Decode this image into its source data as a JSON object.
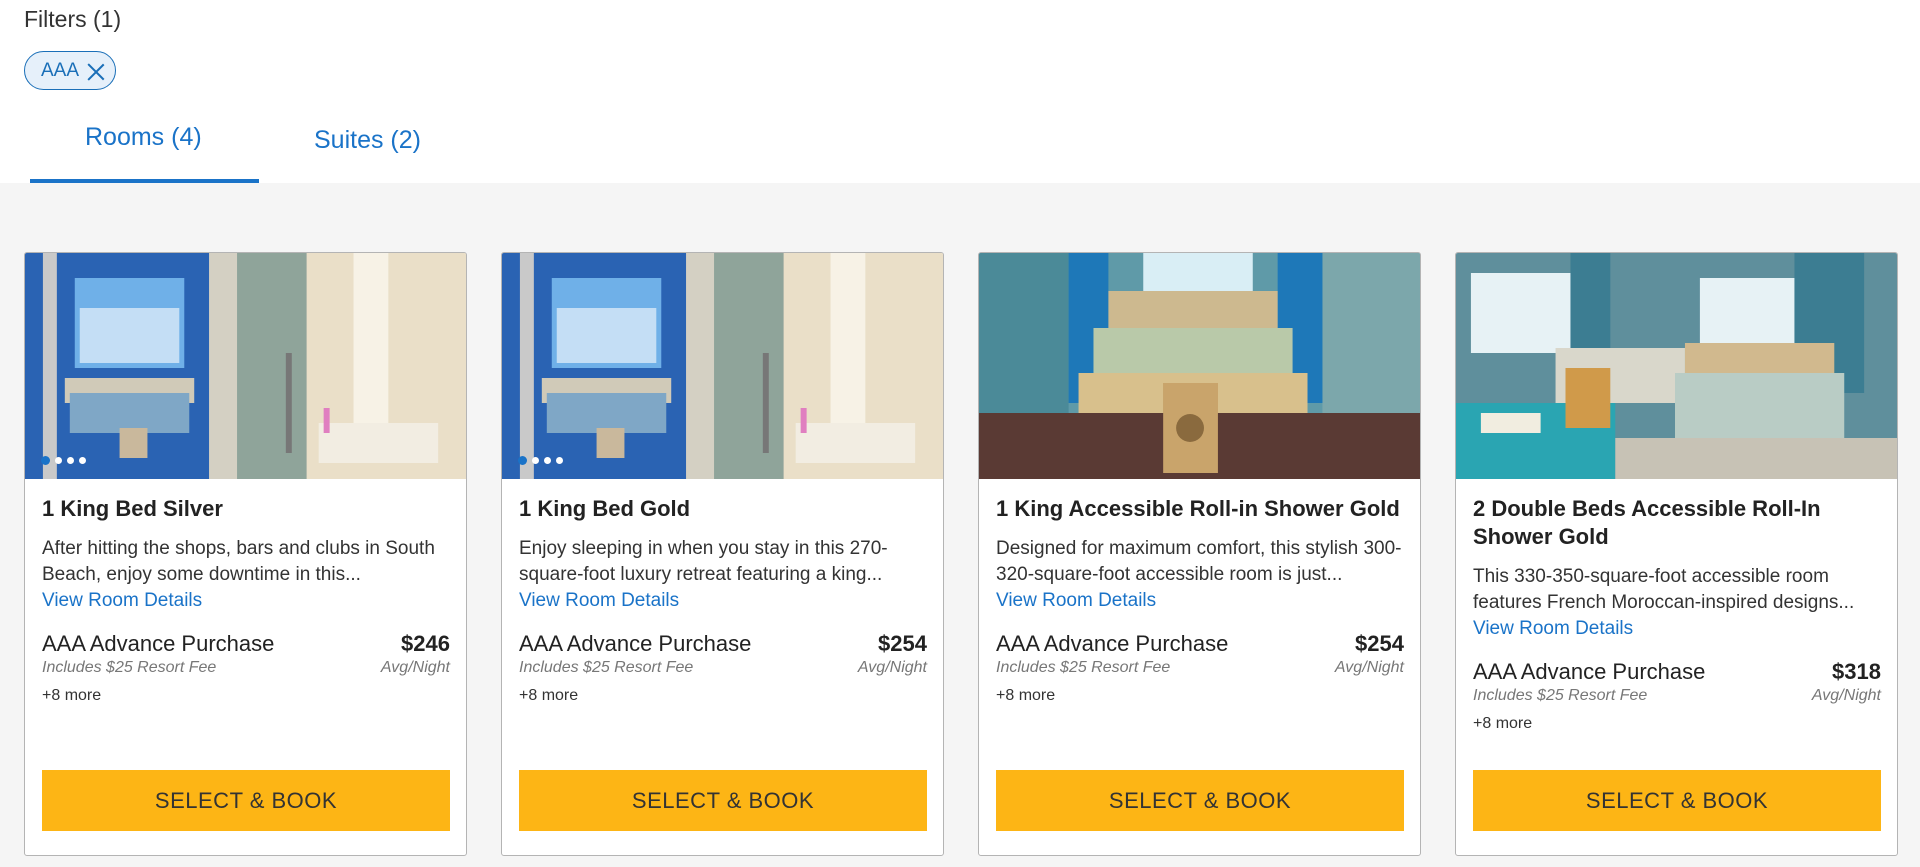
{
  "filters": {
    "title": "Filters (1)",
    "chips": [
      {
        "label": "AAA"
      }
    ]
  },
  "tabs": [
    {
      "label": "Rooms (4)",
      "active": true
    },
    {
      "label": "Suites (2)",
      "active": false
    }
  ],
  "colors": {
    "accent": "#1a73c8",
    "button": "#fdb515",
    "background": "#f5f5f5"
  },
  "cards": [
    {
      "name": "1 King Bed Silver",
      "description": "After hitting the shops, bars and clubs in South Beach, enjoy some downtime in this...",
      "details_link": "View Room Details",
      "rate_name": "AAA Advance Purchase",
      "price": "$246",
      "fee": "Includes $25 Resort Fee",
      "per": "Avg/Night",
      "more": "+8 more",
      "button": "SELECT & BOOK",
      "carousel_dots": 4,
      "active_dot": 1
    },
    {
      "name": "1 King Bed Gold",
      "description": "Enjoy sleeping in when you stay in this 270-square-foot luxury retreat featuring a king...",
      "details_link": "View Room Details",
      "rate_name": "AAA Advance Purchase",
      "price": "$254",
      "fee": "Includes $25 Resort Fee",
      "per": "Avg/Night",
      "more": "+8 more",
      "button": "SELECT & BOOK",
      "carousel_dots": 4,
      "active_dot": 1
    },
    {
      "name": "1 King Accessible Roll-in Shower Gold",
      "description": "Designed for maximum comfort, this stylish 300-320-square-foot accessible room is just...",
      "details_link": "View Room Details",
      "rate_name": "AAA Advance Purchase",
      "price": "$254",
      "fee": "Includes $25 Resort Fee",
      "per": "Avg/Night",
      "more": "+8 more",
      "button": "SELECT & BOOK",
      "carousel_dots": 0,
      "active_dot": 0
    },
    {
      "name": "2 Double Beds Accessible Roll-In Shower Gold",
      "description": "This 330-350-square-foot accessible room features French Moroccan-inspired designs...",
      "details_link": "View Room Details",
      "rate_name": "AAA Advance Purchase",
      "price": "$318",
      "fee": "Includes $25 Resort Fee",
      "per": "Avg/Night",
      "more": "+8 more",
      "button": "SELECT & BOOK",
      "carousel_dots": 0,
      "active_dot": 0
    }
  ]
}
